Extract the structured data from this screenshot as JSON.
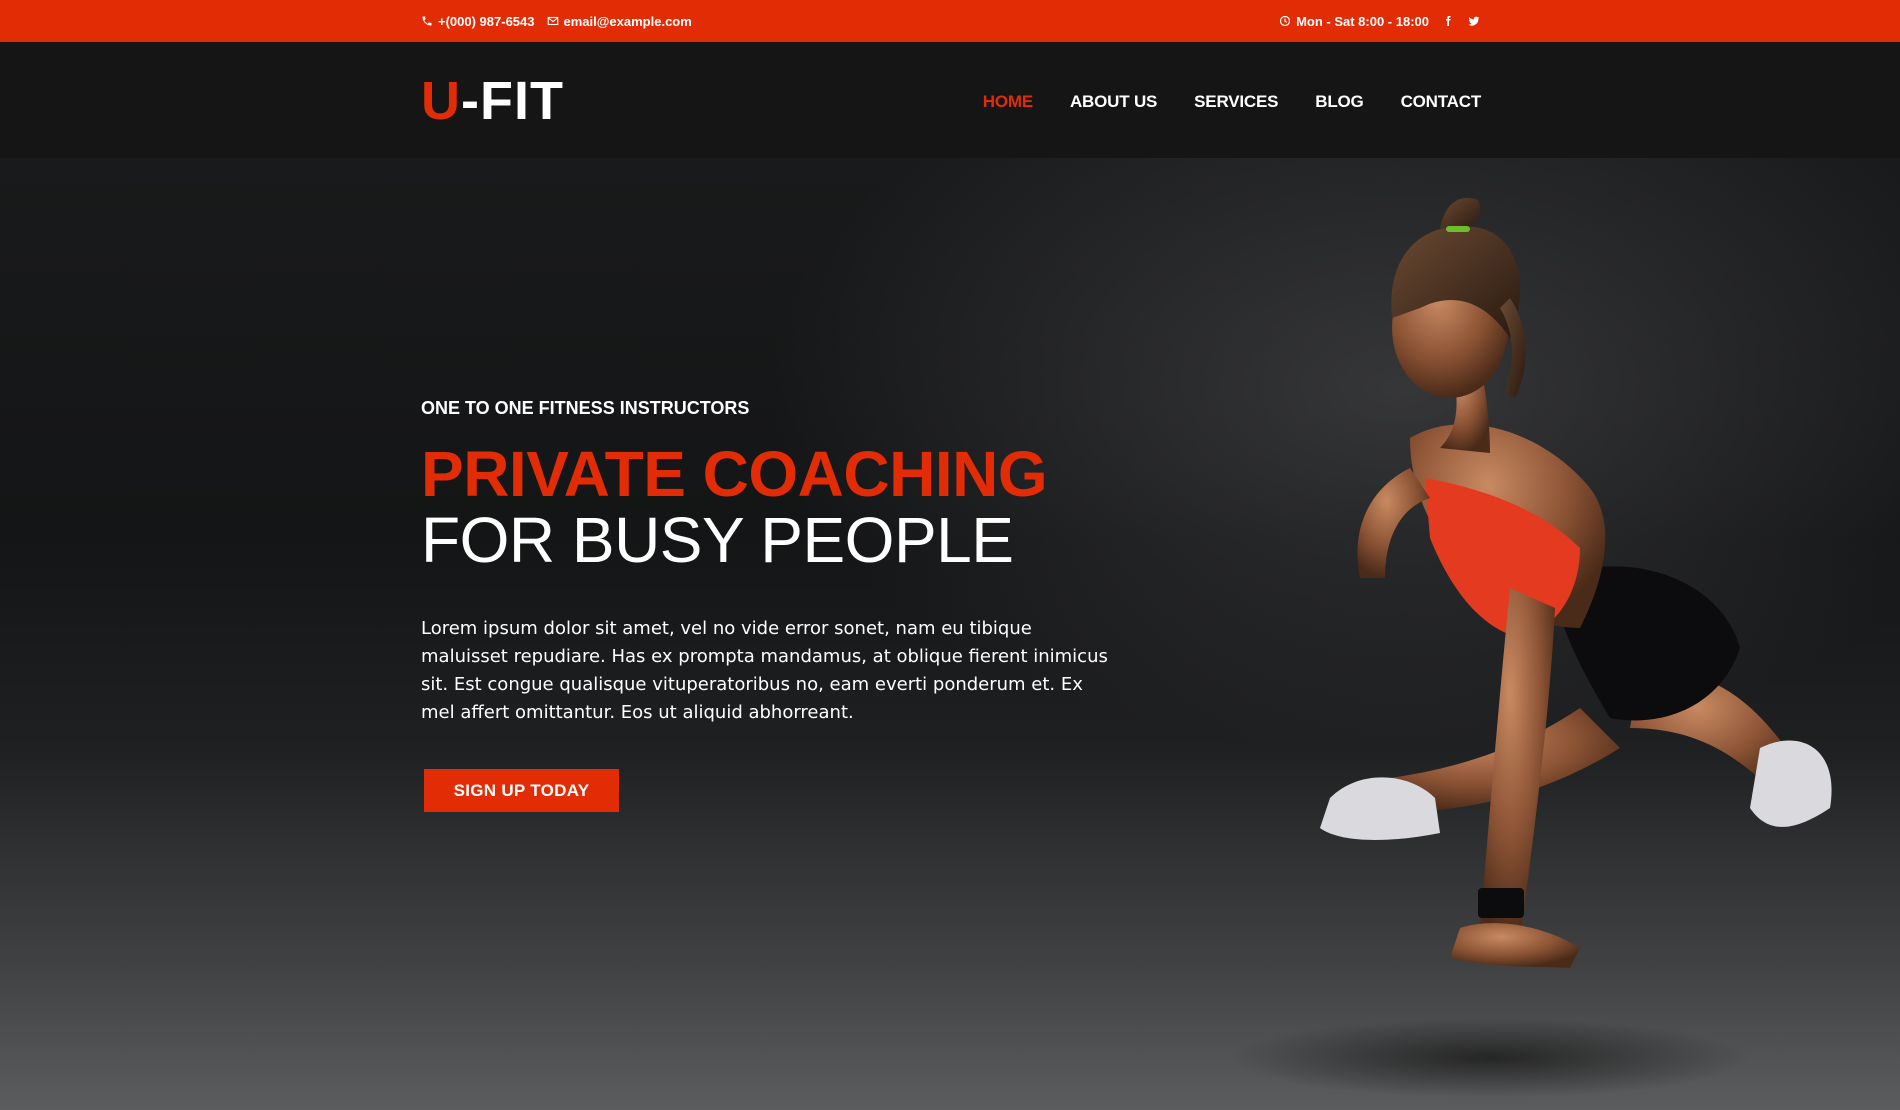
{
  "topbar": {
    "phone": "+(000) 987-6543",
    "email": "email@example.com",
    "hours": "Mon - Sat 8:00 - 18:00",
    "social": [
      "facebook-icon",
      "twitter-icon"
    ]
  },
  "header": {
    "logo_accent": "U",
    "logo_rest": "-FIT",
    "nav": [
      {
        "label": "HOME",
        "active": true
      },
      {
        "label": "ABOUT US",
        "active": false
      },
      {
        "label": "SERVICES",
        "active": false
      },
      {
        "label": "BLOG",
        "active": false
      },
      {
        "label": "CONTACT",
        "active": false
      }
    ]
  },
  "hero": {
    "eyebrow": "ONE TO ONE FITNESS INSTRUCTORS",
    "headline": "PRIVATE COACHING",
    "subline": "FOR BUSY PEOPLE",
    "lead": "Lorem ipsum dolor sit amet, vel no vide error sonet, nam eu tibique maluisset repudiare. Has ex prompta mandamus, at oblique fierent inimicus sit. Est congue qualisque vituperatoribus no, eam everti ponderum et. Ex mel affert omittantur. Eos ut aliquid abhorreant.",
    "cta": "SIGN UP TODAY"
  },
  "colors": {
    "accent": "#e12c06",
    "header_bg": "#151516",
    "text": "#ffffff"
  }
}
